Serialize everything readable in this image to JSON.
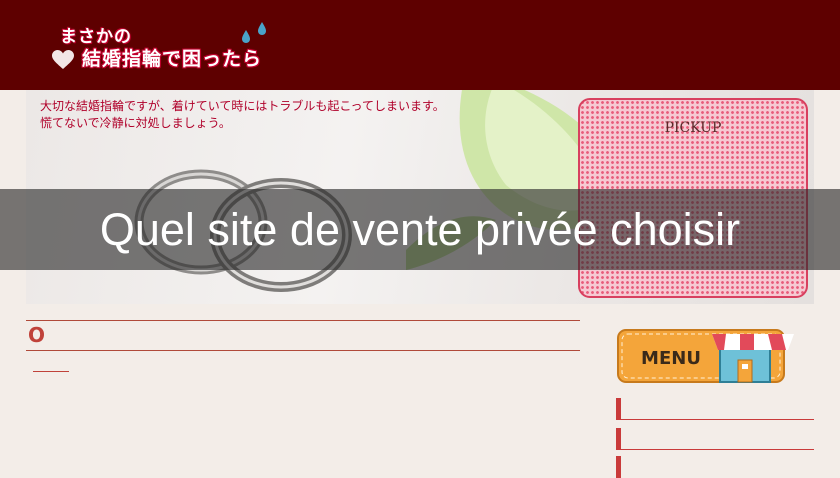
{
  "header": {
    "logo_line1": "まさかの",
    "logo_line2": "結婚指輪で困ったら"
  },
  "hero": {
    "text_line1": "大切な結婚指輪ですが、着けていて時にはトラブルも起こってしまいます。",
    "text_line2": "慌てないで冷静に対処しましょう。"
  },
  "pickup": {
    "label": "PICKUP"
  },
  "overlay": {
    "title": "Quel site de vente privée choisir"
  },
  "content": {
    "heading": "O"
  },
  "sidebar": {
    "menu_label": "MENU"
  },
  "colors": {
    "header_bg": "#5e0000",
    "accent_red": "#c93a3a",
    "pickup_pink": "#f6c9d2",
    "menu_orange": "#f4a53a"
  }
}
